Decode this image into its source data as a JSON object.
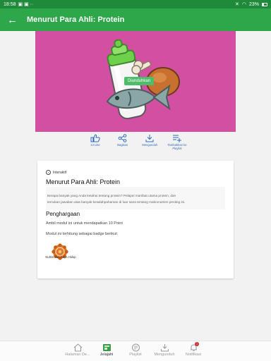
{
  "status_bar": {
    "time": "18:58",
    "notification_icons": "▣ ▣ ··",
    "battery": "23%"
  },
  "app_bar": {
    "back_icon": "arrow-left-icon",
    "title": "Menurut Para Ahli: Protein",
    "bg_color": "#2ea74a"
  },
  "hero": {
    "bg_color": "#d24fa1",
    "tooltip": "Diunduhkan"
  },
  "actions": [
    {
      "label": "13 Like",
      "icon": "thumbs-up-icon"
    },
    {
      "label": "Bagikan",
      "icon": "share-icon"
    },
    {
      "label": "Mengunduh",
      "icon": "download-icon"
    },
    {
      "label": "Tambahkan ke Playlist",
      "icon": "playlist-add-icon"
    }
  ],
  "module": {
    "type_label": "Interaktif",
    "title": "Menurut Para Ahli: Protein",
    "description": [
      "Berapa banyak yang Anda ketahui tentang protein? Pelajari manfaat utama protein, dan",
      "temukan jawaban atas banyak kesalahpahaman di luar sana tentang makronutrien penting ini."
    ],
    "awards_title": "Penghargaan",
    "points_text": "Ambil modul ini untuk mendapatkan 10 Point",
    "badge_text": "Modul ini terhitung sebagai badge berikut:",
    "badge_name": "Nutrisi dan Gaya Hidup"
  },
  "bottom_nav": [
    {
      "label": "Halaman De...",
      "icon": "home-icon",
      "active": false
    },
    {
      "label": "Jelajahi",
      "icon": "explore-icon",
      "active": true
    },
    {
      "label": "Playlist",
      "icon": "playlist-icon",
      "active": false
    },
    {
      "label": "Mengunduh",
      "icon": "download-icon",
      "active": false
    },
    {
      "label": "Notifikasi",
      "icon": "bell-icon",
      "active": false,
      "badge": "1"
    }
  ]
}
